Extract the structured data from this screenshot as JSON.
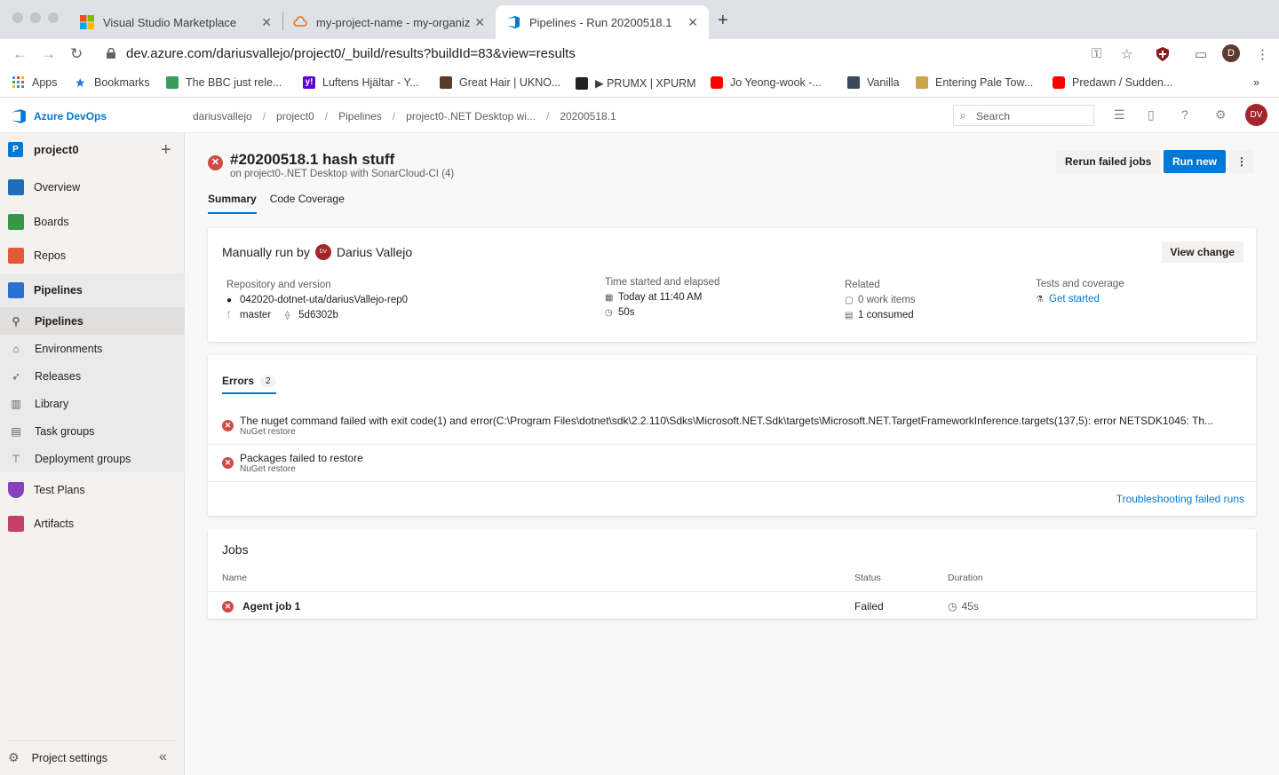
{
  "browser": {
    "tabs": [
      {
        "title": "Visual Studio Marketplace",
        "active": false
      },
      {
        "title": "my-project-name - my-organiz",
        "active": false
      },
      {
        "title": "Pipelines - Run 20200518.1",
        "active": true
      }
    ],
    "url": "dev.azure.com/dariusvallejo/project0/_build/results?buildId=83&view=results",
    "profile_initial": "D",
    "bookmarks": [
      {
        "label": "Apps",
        "icon": "apps-grid-icon"
      },
      {
        "label": "Bookmarks",
        "icon": "star-icon"
      },
      {
        "label": "The BBC just rele...",
        "icon": "bookmark-favicon"
      },
      {
        "label": "Luftens Hjältar - Y...",
        "icon": "yahoo-icon"
      },
      {
        "label": "Great Hair | UKNO...",
        "icon": "bookmark-favicon"
      },
      {
        "label": "▶ PRUMX | XPURM",
        "icon": "bookmark-favicon"
      },
      {
        "label": "Jo Yeong-wook -...",
        "icon": "youtube-icon"
      },
      {
        "label": "Vanilla",
        "icon": "bookmark-favicon"
      },
      {
        "label": "Entering Pale Tow...",
        "icon": "bookmark-favicon"
      },
      {
        "label": "Predawn / Sudden...",
        "icon": "youtube-icon"
      }
    ],
    "more": "»"
  },
  "header": {
    "brand": "Azure DevOps",
    "breadcrumbs": [
      "dariusvallejo",
      "project0",
      "Pipelines",
      "project0-.NET Desktop wi...",
      "20200518.1"
    ],
    "search_placeholder": "Search",
    "user_initials": "DV"
  },
  "sidebar": {
    "project": "project0",
    "project_initial": "P",
    "items": [
      {
        "label": "Overview"
      },
      {
        "label": "Boards"
      },
      {
        "label": "Repos"
      },
      {
        "label": "Pipelines"
      },
      {
        "label": "Pipelines"
      },
      {
        "label": "Environments"
      },
      {
        "label": "Releases"
      },
      {
        "label": "Library"
      },
      {
        "label": "Task groups"
      },
      {
        "label": "Deployment groups"
      },
      {
        "label": "Test Plans"
      },
      {
        "label": "Artifacts"
      }
    ],
    "settings": "Project settings"
  },
  "run": {
    "title": "#20200518.1 hash stuff",
    "subtitle": "on project0-.NET Desktop with SonarCloud-CI (4)",
    "rerun_label": "Rerun failed jobs",
    "run_new_label": "Run new",
    "tabs": [
      "Summary",
      "Code Coverage"
    ],
    "manual_prefix": "Manually run by",
    "user_name": "Darius Vallejo",
    "user_initials": "DV",
    "view_change": "View change",
    "repo_label": "Repository and version",
    "repo": "042020-dotnet-uta/dariusVallejo-rep0",
    "branch": "master",
    "commit": "5d6302b",
    "time_label": "Time started and elapsed",
    "time_started": "Today at 11:40 AM",
    "elapsed": "50s",
    "related_label": "Related",
    "work_items": "0 work items",
    "consumed": "1 consumed",
    "tests_label": "Tests and coverage",
    "get_started": "Get started"
  },
  "errors": {
    "tab_label": "Errors",
    "count": "2",
    "items": [
      {
        "text": "The nuget command failed with exit code(1) and error(C:\\Program Files\\dotnet\\sdk\\2.2.110\\Sdks\\Microsoft.NET.Sdk\\targets\\Microsoft.NET.TargetFrameworkInference.targets(137,5): error NETSDK1045: Th...",
        "source": "NuGet restore"
      },
      {
        "text": "Packages failed to restore",
        "source": "NuGet restore"
      }
    ],
    "troubleshoot": "Troubleshooting failed runs"
  },
  "jobs": {
    "title": "Jobs",
    "columns": [
      "Name",
      "Status",
      "Duration"
    ],
    "rows": [
      {
        "name": "Agent job 1",
        "status": "Failed",
        "duration": "45s"
      }
    ]
  }
}
